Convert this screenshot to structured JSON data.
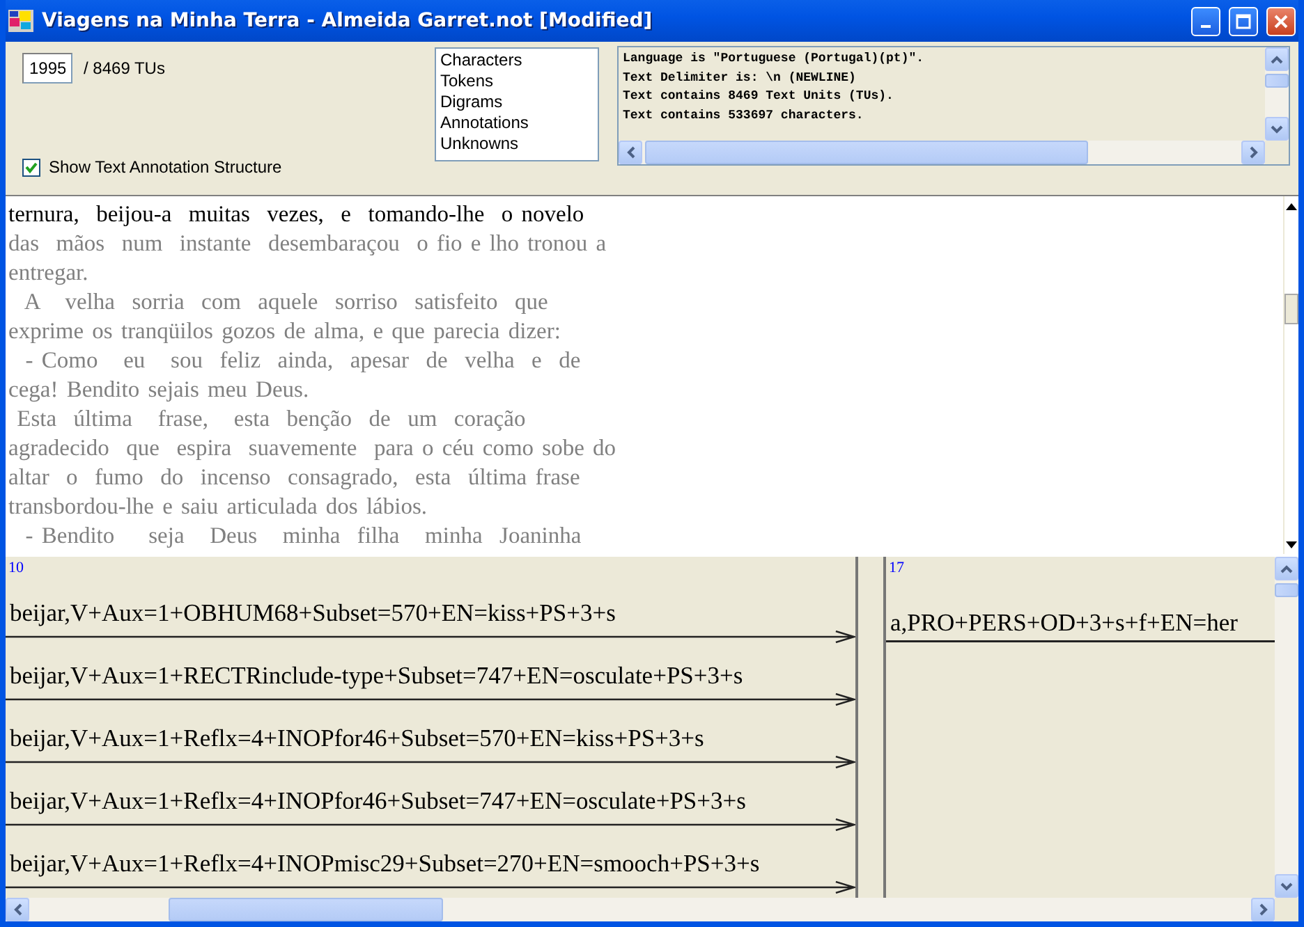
{
  "window": {
    "title": "Viagens na Minha Terra - Almeida Garret.not [Modified]"
  },
  "tu": {
    "value": "1995",
    "total": "/ 8469 TUs"
  },
  "show_structure": {
    "label": "Show Text Annotation Structure",
    "checked": true
  },
  "stats_list": [
    "Characters",
    "Tokens",
    "Digrams",
    "Annotations",
    "Unknowns"
  ],
  "log": [
    "Language is \"Portuguese (Portugal)(pt)\".",
    "Text Delimiter is: \\n (NEWLINE)",
    "Text contains 8469 Text Units (TUs).",
    "Text contains 533697 characters."
  ],
  "editor_lines": [
    {
      "text": "ternura,  beijou-a  muitas  vezes,  e  tomando-lhe  o novelo",
      "current": true
    },
    {
      "text": "das  mãos  num  instante  desembaraçou  o fio e lho tronou a",
      "current": false
    },
    {
      "text": "entregar.",
      "current": false
    },
    {
      "text": "  A   velha  sorria  com  aquele  sorriso  satisfeito  que",
      "current": false
    },
    {
      "text": "exprime os tranqüilos gozos de alma, e que parecia dizer:",
      "current": false
    },
    {
      "text": "  - Como   eu   sou  feliz  ainda,  apesar  de  velha  e  de",
      "current": false
    },
    {
      "text": "cega! Bendito sejais meu Deus.",
      "current": false
    },
    {
      "text": " Esta  última   frase,   esta  benção  de  um  coração",
      "current": false
    },
    {
      "text": "agradecido  que  espira  suavemente  para o céu como sobe do",
      "current": false
    },
    {
      "text": "altar  o  fumo  do  incenso  consagrado,  esta  última frase",
      "current": false
    },
    {
      "text": "transbordou-lhe e saiu articulada dos lábios.",
      "current": false
    },
    {
      "text": "  - Bendito    seja   Deus   minha  filha   minha  Joaninha",
      "current": false
    }
  ],
  "graph": {
    "columns": [
      {
        "index": "10",
        "entries": [
          "beijar,V+Aux=1+OBHUM68+Subset=570+EN=kiss+PS+3+s",
          "beijar,V+Aux=1+RECTRinclude-type+Subset=747+EN=osculate+PS+3+s",
          "beijar,V+Aux=1+Reflx=4+INOPfor46+Subset=570+EN=kiss+PS+3+s",
          "beijar,V+Aux=1+Reflx=4+INOPfor46+Subset=747+EN=osculate+PS+3+s",
          "beijar,V+Aux=1+Reflx=4+INOPmisc29+Subset=270+EN=smooch+PS+3+s"
        ]
      },
      {
        "index": "17",
        "entries": [
          "a,PRO+PERS+OD+3+s+f+EN=her"
        ]
      }
    ]
  }
}
